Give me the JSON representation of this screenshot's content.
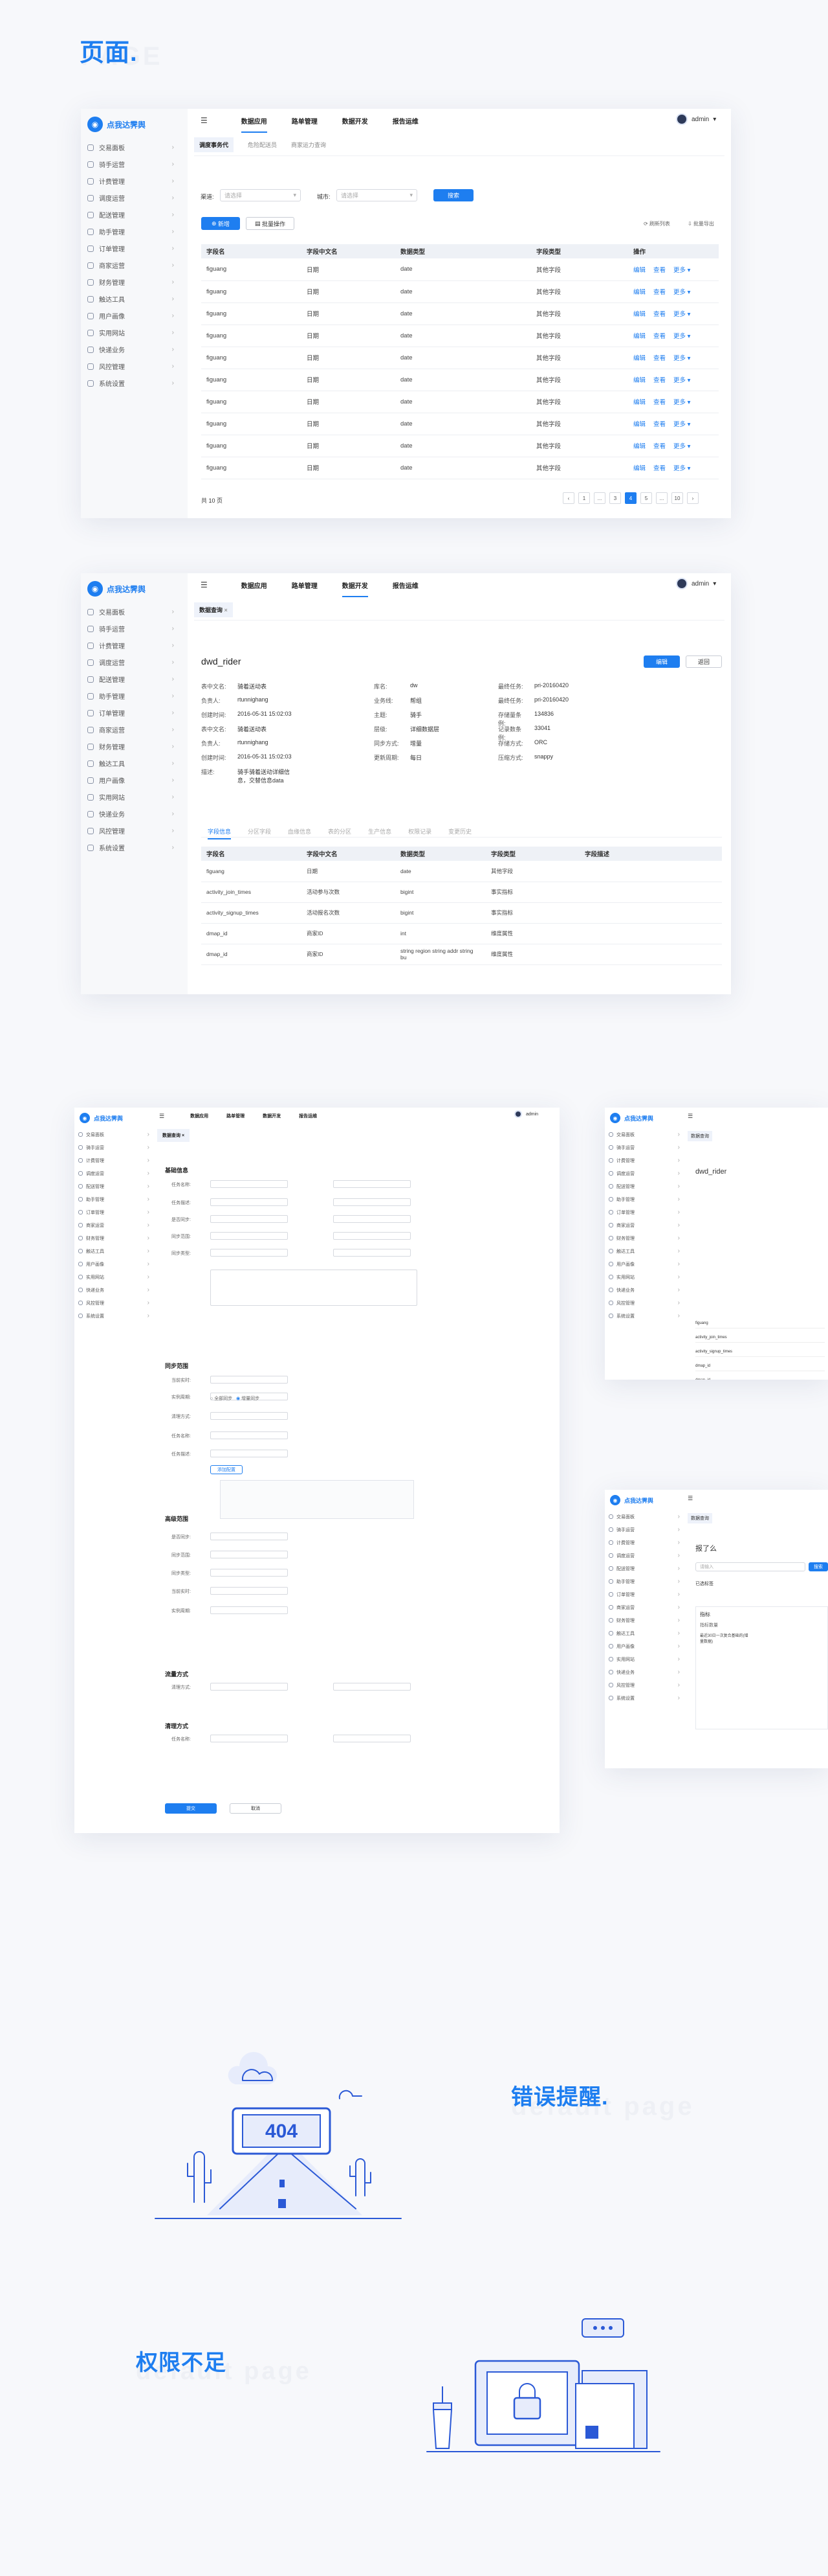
{
  "section_title": "页面.",
  "section_ghost": "PAGE",
  "app": {
    "brand": "点我达霁舆",
    "user": "admin",
    "nav": [
      "数据应用",
      "路单管理",
      "数据开发",
      "报告运维"
    ],
    "sidebar": [
      "交易面板",
      "骑手运营",
      "计费管理",
      "调度运营",
      "配送管理",
      "助手管理",
      "订单管理",
      "商家运营",
      "财务管理",
      "触达工具",
      "用户画像",
      "实用网站",
      "快递业务",
      "风控管理",
      "系统设置"
    ]
  },
  "screen1": {
    "tabs": [
      "调度事务代",
      "危险配送员",
      "商家运力查询"
    ],
    "filter_label_1": "渠道:",
    "filter_placeholder_1": "请选择",
    "filter_label_2": "城市:",
    "filter_placeholder_2": "请选择",
    "search_button": "搜索",
    "add_button": "新增",
    "batch_button": "批量操作",
    "right_actions": [
      "刷新列表",
      "批量导出"
    ],
    "columns": [
      "字段名",
      "字段中文名",
      "数据类型",
      "字段类型",
      "操作"
    ],
    "rows": [
      [
        "figuang",
        "日期",
        "date",
        "其他字段"
      ],
      [
        "figuang",
        "日期",
        "date",
        "其他字段"
      ],
      [
        "figuang",
        "日期",
        "date",
        "其他字段"
      ],
      [
        "figuang",
        "日期",
        "date",
        "其他字段"
      ],
      [
        "figuang",
        "日期",
        "date",
        "其他字段"
      ],
      [
        "figuang",
        "日期",
        "date",
        "其他字段"
      ],
      [
        "figuang",
        "日期",
        "date",
        "其他字段"
      ],
      [
        "figuang",
        "日期",
        "date",
        "其他字段"
      ],
      [
        "figuang",
        "日期",
        "date",
        "其他字段"
      ],
      [
        "figuang",
        "日期",
        "date",
        "其他字段"
      ]
    ],
    "ops": [
      "编辑",
      "查看",
      "更多"
    ],
    "total": "共 10 页",
    "pages": [
      "‹",
      "1",
      "...",
      "3",
      "4",
      "5",
      "...",
      "10",
      "›"
    ],
    "current_page": "4"
  },
  "screen2": {
    "tab": "数据查询",
    "title": "dwd_rider",
    "btn_primary": "编辑",
    "btn_secondary": "返回",
    "info_left": [
      [
        "表中文名:",
        "骑着送动表"
      ],
      [
        "负责人:",
        "rtunnighang"
      ],
      [
        "创建时间:",
        "2016-05-31 15:02:03"
      ],
      [
        "表中文名:",
        "骑着送动表"
      ],
      [
        "负责人:",
        "rtunnighang"
      ],
      [
        "创建时间:",
        "2016-05-31 15:02:03"
      ],
      [
        "描述:",
        "骑手骑着送动详细信息，交替信息data"
      ]
    ],
    "info_mid": [
      [
        "库名:",
        "dw"
      ],
      [
        "业务线:",
        "帮组"
      ],
      [
        "主题:",
        "骑手"
      ],
      [
        "层级:",
        "详细数据层"
      ],
      [
        "同步方式:",
        "增量"
      ],
      [
        "更新周期:",
        "每日"
      ]
    ],
    "info_right": [
      [
        "最终任务:",
        "pri-20160420"
      ],
      [
        "最终任务:",
        "pri-20160420"
      ],
      [
        "存储量条例:",
        "134836"
      ],
      [
        "记录数条例:",
        "33041"
      ],
      [
        "存储方式:",
        "ORC"
      ],
      [
        "压缩方式:",
        "snappy"
      ]
    ],
    "subtabs": [
      "字段信息",
      "分区字段",
      "血缘信息",
      "表的分区",
      "生产信息",
      "权限记录",
      "变更历史"
    ],
    "columns": [
      "字段名",
      "字段中文名",
      "数据类型",
      "字段类型",
      "字段描述"
    ],
    "rows": [
      [
        "figuang",
        "日期",
        "date",
        "其他字段"
      ],
      [
        "activity_join_times",
        "活动参与次数",
        "bigint",
        "事实指标"
      ],
      [
        "activity_signup_times",
        "活动报名次数",
        "bigint",
        "事实指标"
      ],
      [
        "dmap_id",
        "商家ID",
        "int",
        "维度属性"
      ],
      [
        "dmap_id",
        "商家ID",
        "string region string addr string bu",
        "维度属性"
      ]
    ]
  },
  "screen3": {
    "tab": "数据查询",
    "sections": [
      "基础信息",
      "同步范围",
      "高级范围",
      "流量方式",
      "清理方式"
    ],
    "labels": [
      "任务名称:",
      "任务描述:",
      "是否同步:",
      "同步范围:",
      "同步类型:",
      "当前实时:",
      "实例周期:",
      "清理方式:"
    ],
    "radio_1": "全部同步",
    "radio_2": "增量同步",
    "add_button": "添加配置",
    "submit": "提交",
    "cancel": "取消"
  },
  "screen4": {
    "tab": "数据查询",
    "title": "dwd_rider",
    "rows": [
      "figuang",
      "activity_join_times",
      "activity_signup_times",
      "dmap_id",
      "dmap_id"
    ]
  },
  "screen5": {
    "tab": "数据查询",
    "title": "报了么",
    "search_placeholder": "请输入",
    "search_button": "搜索",
    "filter_label": "已选标签",
    "card_title": "指标",
    "card_sub": "指标数量",
    "card_text": "最近30日一次复合基础的(增量数据)"
  },
  "error": {
    "title": "错误提醒.",
    "ghost": "default page",
    "code": "404"
  },
  "forbidden": {
    "title": "权限不足",
    "ghost": "default page"
  },
  "colors": {
    "accent": "#1e7ef0",
    "illustration": "#2b59d6"
  }
}
